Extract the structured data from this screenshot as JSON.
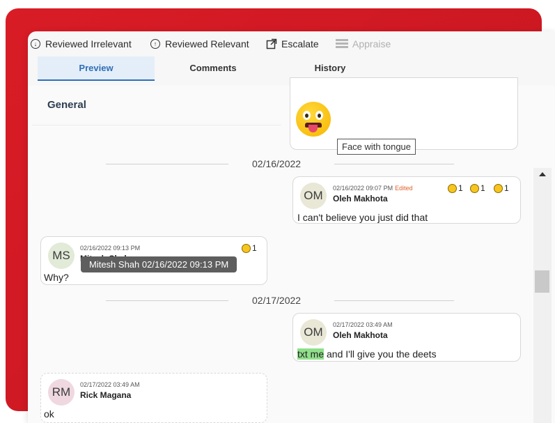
{
  "toolbar": {
    "reviewed_irrelevant": "Reviewed Irrelevant",
    "reviewed_relevant": "Reviewed Relevant",
    "escalate": "Escalate",
    "appraise": "Appraise"
  },
  "tabs": [
    {
      "label": "Preview",
      "active": true
    },
    {
      "label": "Comments",
      "active": false
    },
    {
      "label": "History",
      "active": false
    }
  ],
  "general": {
    "title": "General"
  },
  "emoji_card": {
    "tooltip": "Face with tongue",
    "icon": "face-with-tongue-emoji"
  },
  "dates": {
    "d1": "02/16/2022",
    "d2": "02/17/2022"
  },
  "messages": [
    {
      "initials": "OM",
      "timestamp": "02/16/2022 09:07 PM",
      "edited": "Edited",
      "author": "Oleh Makhota",
      "text": "I can't believe you just did that",
      "reactions": [
        {
          "count": "1"
        },
        {
          "count": "1"
        },
        {
          "count": "1"
        }
      ]
    },
    {
      "initials": "MS",
      "timestamp": "02/16/2022 09:13 PM",
      "author": "Mitesh Shah",
      "text": "Why?",
      "reactions": [
        {
          "count": "1"
        }
      ],
      "hover_tooltip": "Mitesh Shah 02/16/2022 09:13 PM"
    },
    {
      "initials": "OM",
      "timestamp": "02/17/2022 03:49 AM",
      "author": "Oleh Makhota",
      "text_highlight": "txt me",
      "text_rest": " and I'll give you the deets"
    },
    {
      "initials": "RM",
      "timestamp": "02/17/2022 03:49 AM",
      "author": "Rick Magana",
      "text": "ok"
    }
  ],
  "colors": {
    "accent": "#2e6fb7",
    "brand_red": "#d91c26",
    "highlight": "#8fe08a",
    "edited": "#e0622b"
  }
}
